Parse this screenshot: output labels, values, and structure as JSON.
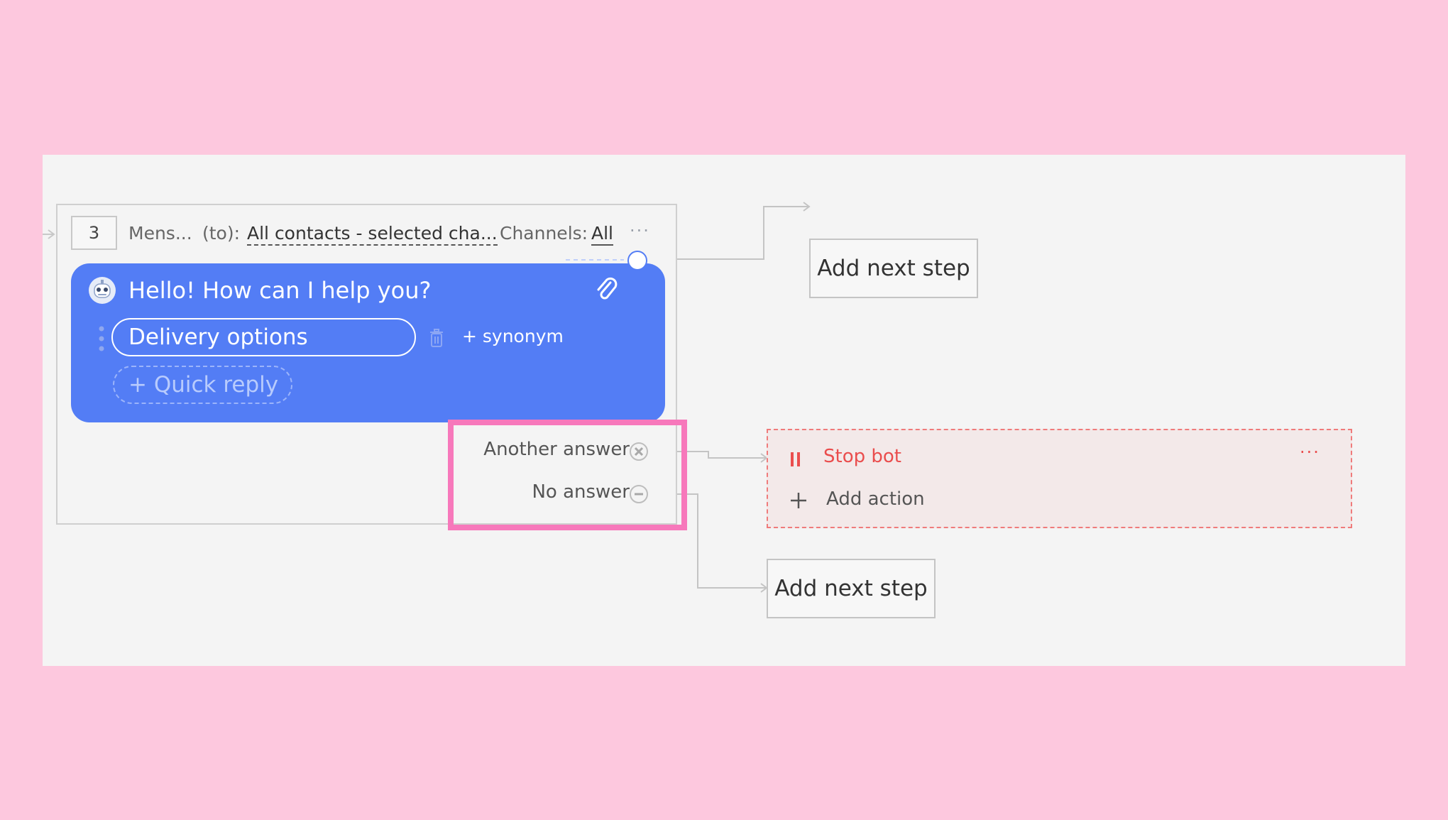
{
  "step": {
    "number": "3",
    "type_label": "Mens...",
    "to_label": "(to):",
    "to_value": "All contacts - selected cha...",
    "channels_label": "Channels:",
    "channels_value": "All",
    "menu_glyph": "···"
  },
  "message": {
    "avatar_icon": "bot-avatar-icon",
    "text": "Hello! How can I help you?",
    "attach_icon": "paperclip-icon"
  },
  "quick_replies": [
    {
      "label": "Delivery options",
      "synonym_label": "+ synonym"
    }
  ],
  "add_quick_reply_label": "+ Quick reply",
  "alternatives": {
    "another_answer": "Another answer",
    "no_answer": "No answer"
  },
  "next_steps": {
    "top_label": "Add next step",
    "bottom_label": "Add next step"
  },
  "stop_action": {
    "label": "Stop bot",
    "menu_glyph": "···",
    "add_action_label": "Add action"
  },
  "colors": {
    "page_background": "#fdc8de",
    "canvas_background": "#f4f4f4",
    "bubble_blue": "#537df5",
    "stop_red": "#ea4d4d",
    "highlight_pink": "#f778bb"
  }
}
